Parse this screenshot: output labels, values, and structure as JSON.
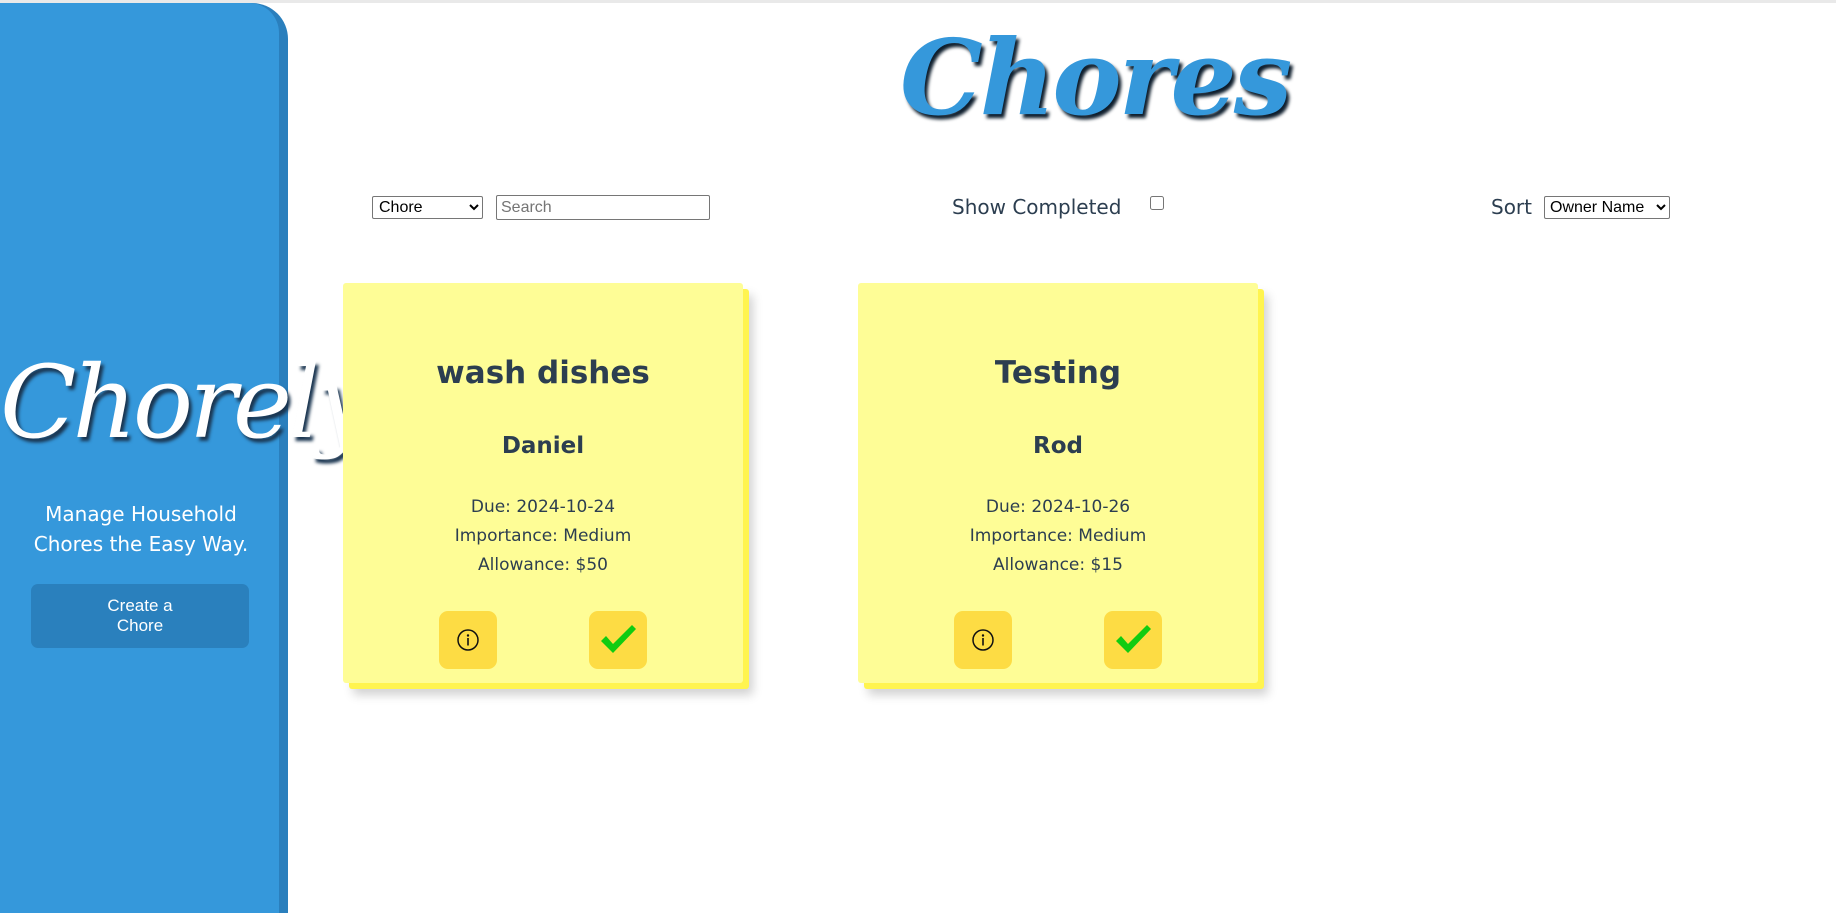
{
  "app": {
    "logo_text": "Chorely",
    "tagline": "Manage Household Chores the Easy Way.",
    "create_button_label": "Create a Chore"
  },
  "page": {
    "title": "Chores"
  },
  "toolbar": {
    "filter_selected": "Chore",
    "search_placeholder": "Search",
    "search_value": "",
    "show_completed_label": "Show Completed",
    "show_completed_checked": false,
    "sort_label": "Sort",
    "sort_selected": "Owner Name"
  },
  "chores": [
    {
      "title": "wash dishes",
      "owner": "Daniel",
      "due": "Due: 2024-10-24",
      "importance": "Importance: Medium",
      "allowance": "Allowance: $50"
    },
    {
      "title": "Testing",
      "owner": "Rod",
      "due": "Due: 2024-10-26",
      "importance": "Importance: Medium",
      "allowance": "Allowance: $15"
    }
  ],
  "icons": {
    "info": "info-icon",
    "complete": "checkmark-icon"
  },
  "colors": {
    "sidebar": "#3598db",
    "card": "#fefd96",
    "card_button": "#fddc44",
    "checkmark": "#11cc11",
    "text": "#2c3e50"
  }
}
